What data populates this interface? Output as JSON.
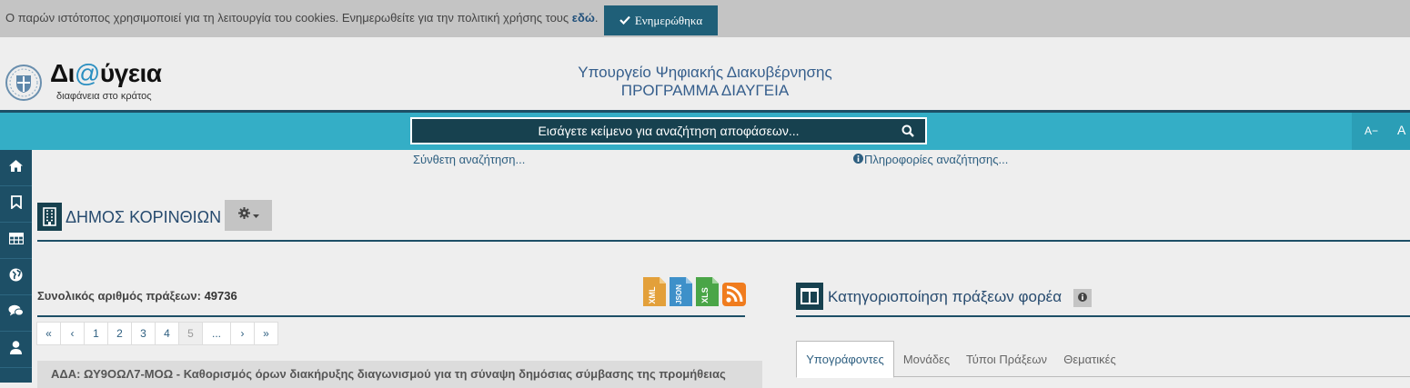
{
  "cookie": {
    "text": "Ο παρών ιστότοπος χρησιμοποιεί για τη λειτουργία του cookies. Ενημερωθείτε για την πολιτική χρήσης τους ",
    "link": "εδώ",
    "after_link": ".",
    "button": "Ενημερώθηκα"
  },
  "header": {
    "logo_part1": "Δι",
    "logo_at": "@",
    "logo_part2": "ύγεια",
    "logo_sub": "διαφάνεια στο κράτος",
    "ministry": "Υπουργείο Ψηφιακής Διακυβέρνησης",
    "program": "ΠΡΟΓΡΑΜΜΑ ΔΙΑΥΓΕΙΑ"
  },
  "search": {
    "placeholder": "Εισάγετε κείμενο για αναζήτηση αποφάσεων...",
    "font_small": "A−",
    "font_large": "A"
  },
  "links": {
    "advanced": "Σύνθετη αναζήτηση...",
    "info": "Πληροφορίες αναζήτησης..."
  },
  "entity": {
    "title": "ΔΗΜΟΣ ΚΟΡΙΝΘΙΩΝ"
  },
  "totals": {
    "label": "Συνολικός αριθμός πράξεων: ",
    "count": "49736"
  },
  "exports": [
    "XML",
    "JSON",
    "XLS",
    "RSS"
  ],
  "pagination": [
    "«",
    "‹",
    "1",
    "2",
    "3",
    "4",
    "5",
    "...",
    "›",
    "»"
  ],
  "pagination_current": "5",
  "result": {
    "text": "ΑΔΑ: ΩΥ9ΟΩΛ7-ΜΟΩ - Καθορισμός όρων διακήρυξης διαγωνισμού για τη σύναψη δημόσιας σύμβασης της προμήθειας"
  },
  "categories": {
    "title": "Κατηγοριοποίηση πράξεων φορέα",
    "tabs": [
      "Υπογράφοντες",
      "Μονάδες",
      "Τύποι Πράξεων",
      "Θεματικές"
    ],
    "active_tab": "Υπογράφοντες"
  },
  "colors": {
    "accent": "#34aec6",
    "dark": "#1d4f66",
    "cookie_button": "#1f5f78"
  },
  "sidebar_icons": [
    "home-icon",
    "bookmark-icon",
    "table-icon",
    "globe-icon",
    "comments-icon",
    "user-icon"
  ]
}
